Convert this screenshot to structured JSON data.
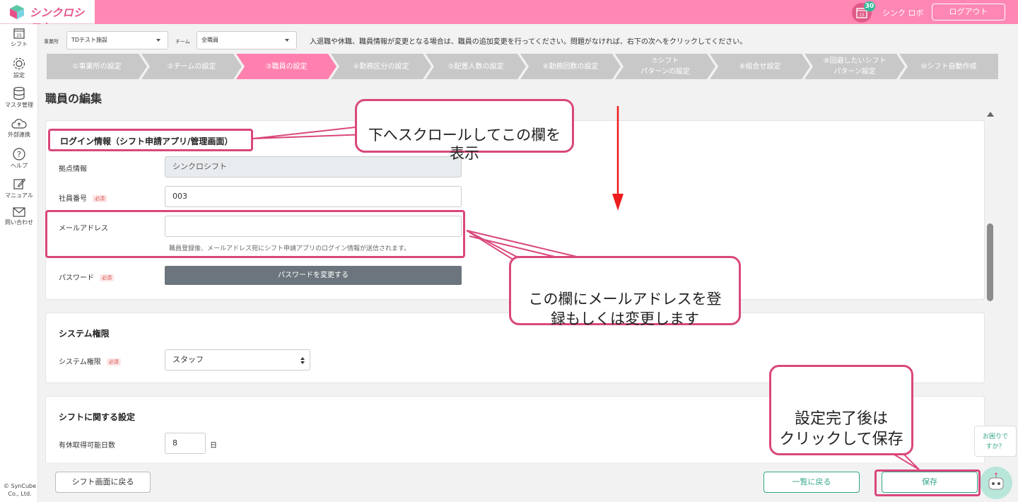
{
  "header": {
    "logo_text": "シンクロシフト",
    "calendar_day": "15",
    "notification_count": "30",
    "user_name": "シンク ロボ",
    "logout_label": "ログアウト"
  },
  "sidebar": {
    "calendar_day": "15",
    "items": [
      {
        "label": "シフト",
        "icon": "calendar-icon"
      },
      {
        "label": "設定",
        "icon": "gear-icon"
      },
      {
        "label": "マスタ管理",
        "icon": "database-icon"
      },
      {
        "label": "外部連携",
        "icon": "cloud-icon"
      },
      {
        "label": "ヘルプ",
        "icon": "help-icon"
      },
      {
        "label": "マニュアル",
        "icon": "manual-icon"
      },
      {
        "label": "問い合わせ",
        "icon": "mail-icon"
      }
    ],
    "copyright": "© SynCube Co., Ltd."
  },
  "topbar": {
    "office_label": "事業所",
    "office_value": "TDテスト施設",
    "team_label": "チーム",
    "team_value": "全職員",
    "notice": "入退職や休職、職員情報が変更となる場合は、職員の追加変更を行ってください。問題がなければ、右下の次へをクリックしてください。"
  },
  "steps": [
    {
      "label": "①事業所の設定"
    },
    {
      "label": "②チームの設定"
    },
    {
      "label": "③職員の設定"
    },
    {
      "label": "④勤務区分の設定"
    },
    {
      "label": "⑤配置人数の設定"
    },
    {
      "label": "⑥勤務回数の設定"
    },
    {
      "label": "⑦シフト\nパターンの設定"
    },
    {
      "label": "⑧組合せ設定"
    },
    {
      "label": "⑨回避したいシフト\nパターン設定"
    },
    {
      "label": "⑩シフト自動作成"
    }
  ],
  "page_title": "職員の編集",
  "login_section": {
    "title": "ログイン情報（シフト申請アプリ/管理画面）",
    "base_label": "拠点情報",
    "base_value": "シンクロシフト",
    "employee_no_label": "社員番号",
    "required_label": "必須",
    "employee_no_value": "003",
    "email_label": "メールアドレス",
    "email_value": "",
    "email_hint": "職員登録後、メールアドレス宛にシフト申請アプリのログイン情報が送信されます。",
    "password_label": "パスワード",
    "password_button": "パスワードを変更する"
  },
  "system_section": {
    "title": "システム権限",
    "role_label": "システム権限",
    "role_value": "スタッフ"
  },
  "shift_section": {
    "title": "シフトに関する設定",
    "paid_leave_label": "有休取得可能日数",
    "paid_leave_value": "8",
    "paid_leave_unit": "日"
  },
  "footer": {
    "back_to_shift": "シフト画面に戻る",
    "back_to_list": "一覧に戻る",
    "save": "保存"
  },
  "help_bubble": "お困りで\nすか？",
  "annotations": {
    "scroll_note": "下へスクロールしてこの欄を\n表示",
    "email_note": "この欄にメールアドレスを登\n録もしくは変更します",
    "save_note": "設定完了後は\nクリックして保存"
  },
  "colors": {
    "brand_pink": "#ff87b4",
    "active_step": "#ff80af",
    "annotation": "#d9477c",
    "accent_green": "#34a58a"
  }
}
